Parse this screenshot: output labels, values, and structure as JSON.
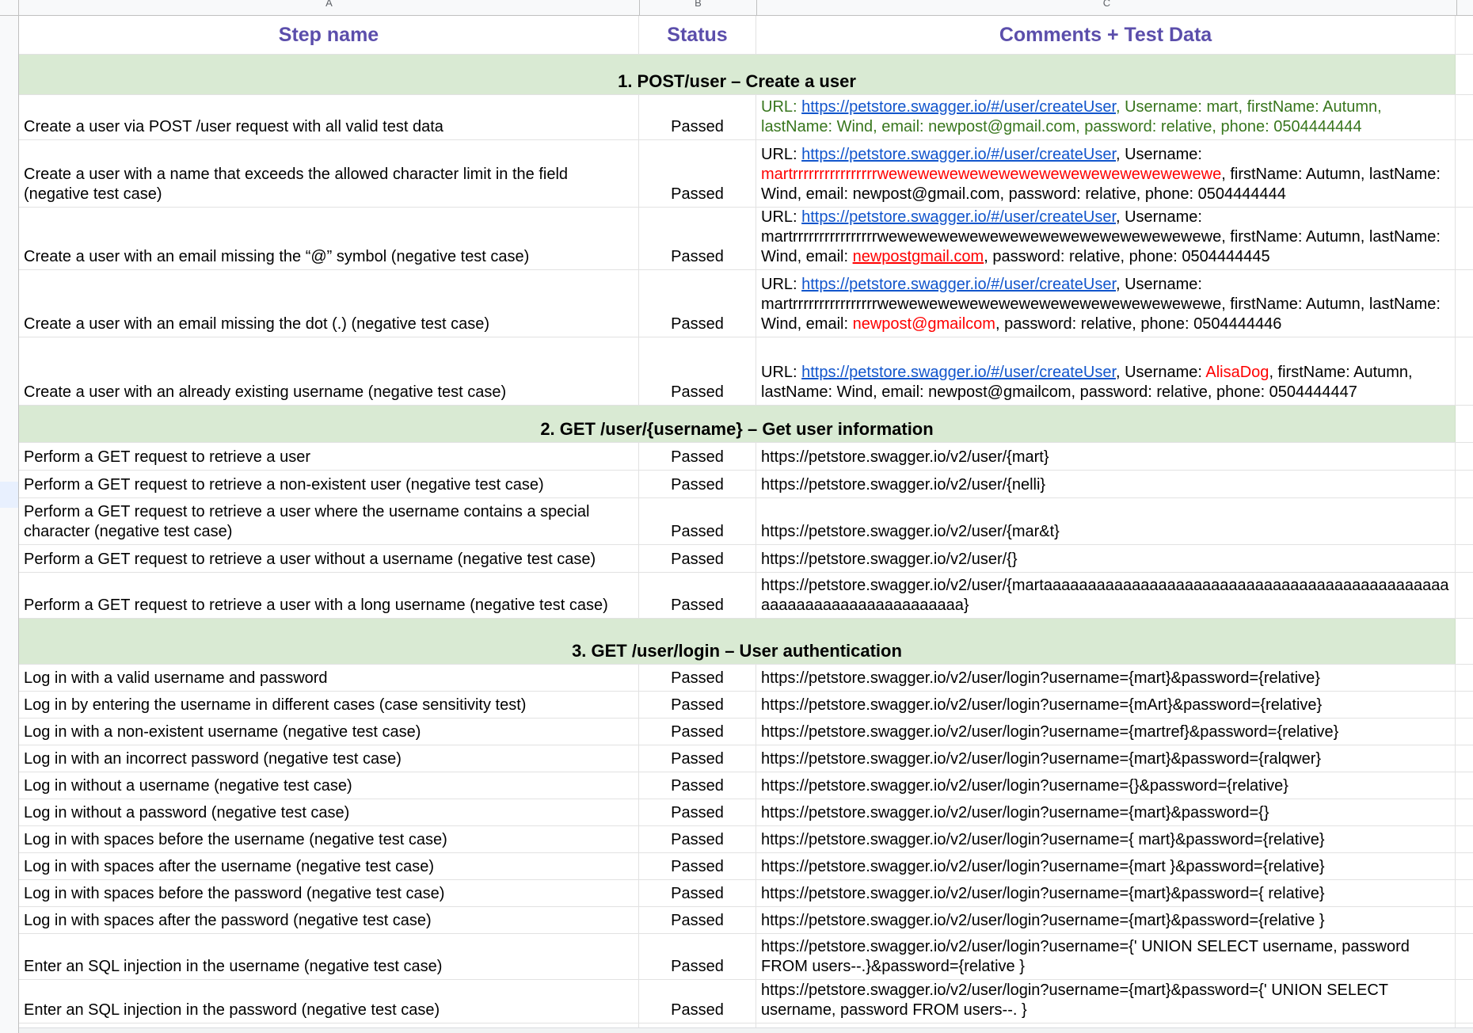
{
  "columns": [
    "A",
    "B",
    "C"
  ],
  "header": {
    "step_name": "Step name",
    "status": "Status",
    "comments": "Comments + Test Data"
  },
  "sections": [
    "1. POST/user – Create a user",
    "2. GET /user/{username} – Get user information",
    "3. GET /user/login – User authentication"
  ],
  "post_rows": [
    {
      "step": "Create a user via POST /user request with all valid test data",
      "status": "Passed",
      "url_label": "URL: ",
      "url": "https://petstore.swagger.io/#/user/createUser",
      "rest": ", Username: mart, firstName: Autumn, lastName: Wind, email: newpost@gmail.com, password: relative, phone: 0504444444"
    },
    {
      "step": "Create a user with a name that exceeds the allowed character limit in the field (negative test case)",
      "status": "Passed",
      "url_label": "URL: ",
      "url": "https://petstore.swagger.io/#/user/createUser",
      "before": ", Username: ",
      "highlight": "martrrrrrrrrrrrrrrrrwewewewewewewewewewewewewewewewewe",
      "after": ", firstName: Autumn, lastName: Wind, email: newpost@gmail.com, password: relative, phone: 0504444444"
    },
    {
      "step": "Create a user with an email missing the “@” symbol (negative test case)",
      "status": "Passed",
      "url_label": "URL: ",
      "url": "https://petstore.swagger.io/#/user/createUser",
      "before": ", Username: martrrrrrrrrrrrrrrrrwewewewewewewewewewewewewewewewewe, firstName: Autumn, lastName: Wind, email: ",
      "highlight": "newpostgmail.com",
      "after": ", password: relative, phone: 0504444445"
    },
    {
      "step": "Create a user with an email missing the dot (.) (negative test case)",
      "status": "Passed",
      "url_label": "URL: ",
      "url": "https://petstore.swagger.io/#/user/createUser",
      "before": ", Username: martrrrrrrrrrrrrrrrrwewewewewewewewewewewewewewewewewe, firstName: Autumn, lastName: Wind, email: ",
      "highlight": "newpost@gmailcom",
      "after": ", password: relative, phone: 0504444446"
    },
    {
      "step": "Create a user with an already existing username (negative test case)",
      "status": "Passed",
      "url_label": "URL: ",
      "url": "https://petstore.swagger.io/#/user/createUser",
      "before": ", Username: ",
      "highlight": "AlisaDog",
      "after": ", firstName: Autumn, lastName: Wind, email: newpost@gmailcom, password: relative, phone: 0504444447"
    }
  ],
  "get_rows": [
    {
      "step": "Perform a GET request to retrieve a user",
      "status": "Passed",
      "comment": "https://petstore.swagger.io/v2/user/{mart}"
    },
    {
      "step": "Perform a GET request to retrieve a non-existent user (negative test case)",
      "status": "Passed",
      "comment": "https://petstore.swagger.io/v2/user/{nelli}"
    },
    {
      "step": "Perform a GET request to retrieve a user where the username contains a special character (negative test case)",
      "status": "Passed",
      "comment": "https://petstore.swagger.io/v2/user/{mar&t}"
    },
    {
      "step": "Perform a GET request to retrieve a user without a username (negative test case)",
      "status": "Passed",
      "comment": "https://petstore.swagger.io/v2/user/{}"
    },
    {
      "step": "Perform a GET request to retrieve a user with a long username (negative test case)",
      "status": "Passed",
      "comment": "https://petstore.swagger.io/v2/user/{martaaaaaaaaaaaaaaaaaaaaaaaaaaaaaaaaaaaaaaaaaaaaaaaaaaaaaaaaaaaaaaaaaaaaa}"
    }
  ],
  "login_rows": [
    {
      "step": "Log in with a valid username and password",
      "status": "Passed",
      "comment": "https://petstore.swagger.io/v2/user/login?username={mart}&password={relative}"
    },
    {
      "step": "Log in by entering the username in different cases (case sensitivity test)",
      "status": "Passed",
      "comment": "https://petstore.swagger.io/v2/user/login?username={mArt}&password={relative}"
    },
    {
      "step": "Log in with a non-existent username (negative test case)",
      "status": "Passed",
      "comment": "https://petstore.swagger.io/v2/user/login?username={martref}&password={relative}"
    },
    {
      "step": "Log in with an incorrect password (negative test case)",
      "status": "Passed",
      "comment": "https://petstore.swagger.io/v2/user/login?username={mart}&password={ralqwer}"
    },
    {
      "step": "Log in without a username (negative test case)",
      "status": "Passed",
      "comment": "https://petstore.swagger.io/v2/user/login?username={}&password={relative}"
    },
    {
      "step": "Log in without a password (negative test case)",
      "status": "Passed",
      "comment": "https://petstore.swagger.io/v2/user/login?username={mart}&password={}"
    },
    {
      "step": "Log in with spaces before the username (negative test case)",
      "status": "Passed",
      "comment": "https://petstore.swagger.io/v2/user/login?username={ mart}&password={relative}"
    },
    {
      "step": "Log in with spaces after the username (negative test case)",
      "status": "Passed",
      "comment": "https://petstore.swagger.io/v2/user/login?username={mart }&password={relative}"
    },
    {
      "step": "Log in with spaces before the password (negative test case)",
      "status": "Passed",
      "comment": "https://petstore.swagger.io/v2/user/login?username={mart}&password={ relative}"
    },
    {
      "step": "Log in with spaces after the password (negative test case)",
      "status": "Passed",
      "comment": "https://petstore.swagger.io/v2/user/login?username={mart}&password={relative }"
    },
    {
      "step": "Enter an SQL injection in the username (negative test case)",
      "status": "Passed",
      "comment": "https://petstore.swagger.io/v2/user/login?username={' UNION SELECT username, password FROM users--.}&password={relative }"
    },
    {
      "step": "Enter an SQL injection in the password (negative test case)",
      "status": "Passed",
      "comment": "https://petstore.swagger.io/v2/user/login?username={mart}&password={' UNION SELECT username, password FROM users--. }"
    }
  ]
}
